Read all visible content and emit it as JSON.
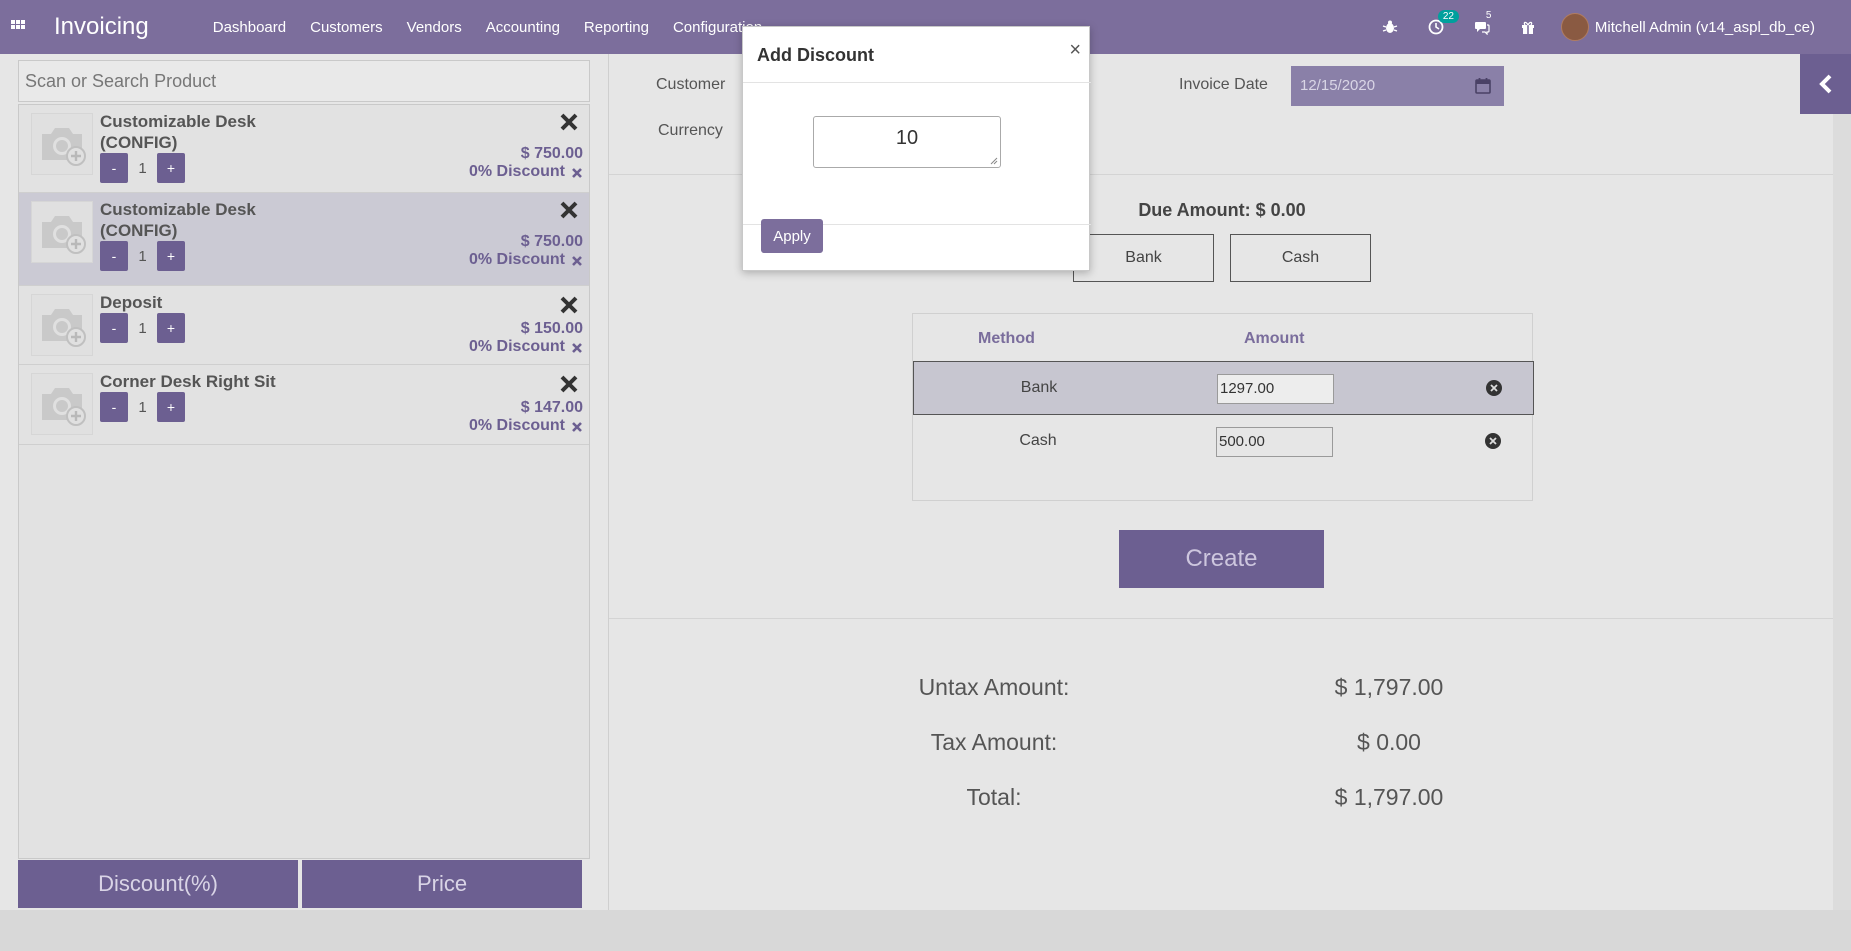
{
  "navbar": {
    "app_name": "Invoicing",
    "menu": [
      "Dashboard",
      "Customers",
      "Vendors",
      "Accounting",
      "Reporting",
      "Configuration"
    ],
    "activity_count": "22",
    "message_count": "5",
    "user_name": "Mitchell Admin (v14_aspl_db_ce)"
  },
  "search": {
    "placeholder": "Scan or Search Product"
  },
  "order_lines": [
    {
      "name": "Customizable Desk (CONFIG)",
      "qty": "1",
      "price": "$ 750.00",
      "discount": "0% Discount",
      "selected": false
    },
    {
      "name": "Customizable Desk (CONFIG)",
      "qty": "1",
      "price": "$ 750.00",
      "discount": "0% Discount",
      "selected": true
    },
    {
      "name": "Deposit",
      "qty": "1",
      "price": "$ 150.00",
      "discount": "0% Discount",
      "selected": false
    },
    {
      "name": "Corner Desk Right Sit",
      "qty": "1",
      "price": "$ 147.00",
      "discount": "0% Discount",
      "selected": false
    }
  ],
  "qty_controls": {
    "minus": "-",
    "plus": "+"
  },
  "left_buttons": {
    "discount": "Discount(%)",
    "price": "Price"
  },
  "form": {
    "customer_label": "Customer",
    "currency_label": "Currency",
    "invoice_date_label": "Invoice Date",
    "invoice_date": "12/15/2020"
  },
  "payment": {
    "due_amount": "Due Amount: $ 0.00",
    "methods": [
      "Bank",
      "Cash"
    ],
    "table_headers": {
      "method": "Method",
      "amount": "Amount"
    },
    "lines": [
      {
        "method": "Bank",
        "amount": "1297.00",
        "active": true
      },
      {
        "method": "Cash",
        "amount": "500.00",
        "active": false
      }
    ],
    "create_label": "Create"
  },
  "totals": {
    "untax_label": "Untax Amount:",
    "untax_value": "$ 1,797.00",
    "tax_label": "Tax Amount:",
    "tax_value": "$ 0.00",
    "total_label": "Total:",
    "total_value": "$ 1,797.00"
  },
  "modal": {
    "title": "Add Discount",
    "close": "×",
    "discount_value": "10",
    "apply_label": "Apply"
  },
  "colors": {
    "primary": "#7c6e9c",
    "primary_dark": "#6c5f91",
    "badge": "#00a09d"
  }
}
